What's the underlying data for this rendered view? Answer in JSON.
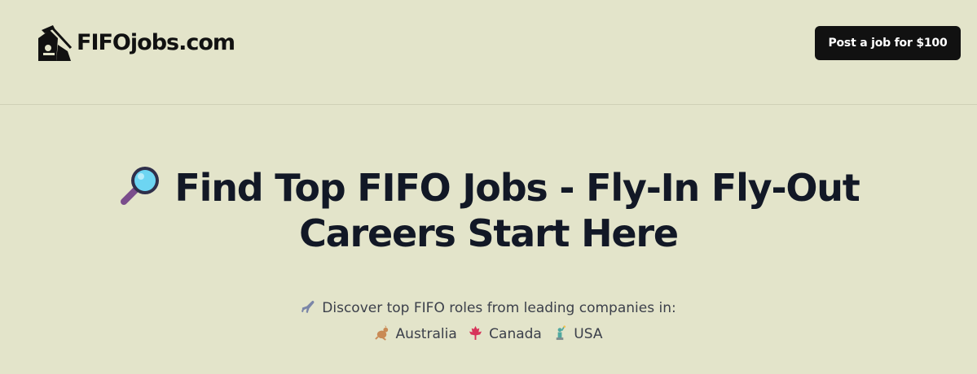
{
  "header": {
    "logo_text": "FIFOjobs.com",
    "post_job_label": "Post a job for $100"
  },
  "hero": {
    "title": "Find Top FIFO Jobs - Fly-In Fly-Out Careers Start Here",
    "subtitle": "Discover top FIFO roles from leading companies in:",
    "countries": [
      {
        "name": "Australia",
        "icon": "kangaroo-icon"
      },
      {
        "name": "Canada",
        "icon": "maple-leaf-icon"
      },
      {
        "name": "USA",
        "icon": "statue-of-liberty-icon"
      }
    ]
  },
  "colors": {
    "background": "#e3e4ca",
    "button": "#111111",
    "title": "#121826"
  }
}
